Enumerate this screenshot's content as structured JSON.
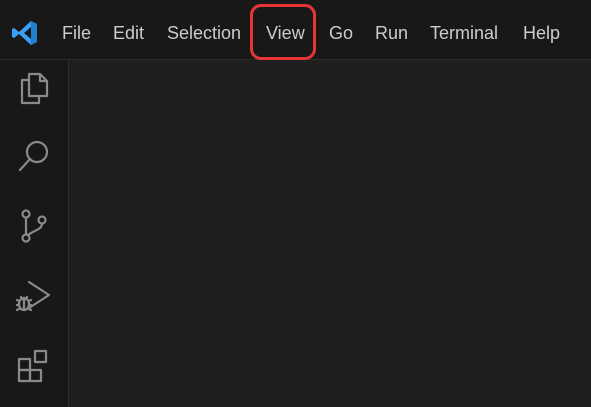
{
  "app": {
    "name": "Visual Studio Code",
    "logo_icon": "vscode-logo-icon",
    "logo_color": "#3aa0f3"
  },
  "menu": {
    "items": [
      {
        "label": "File"
      },
      {
        "label": "Edit"
      },
      {
        "label": "Selection"
      },
      {
        "label": "View"
      },
      {
        "label": "Go"
      },
      {
        "label": "Run"
      },
      {
        "label": "Terminal"
      },
      {
        "label": "Help"
      }
    ],
    "highlighted": "View",
    "highlight_color": "#e53535"
  },
  "activity_bar": {
    "items": [
      {
        "name": "explorer",
        "icon": "files-icon"
      },
      {
        "name": "search",
        "icon": "search-icon"
      },
      {
        "name": "source-control",
        "icon": "source-control-icon"
      },
      {
        "name": "run-and-debug",
        "icon": "run-debug-icon"
      },
      {
        "name": "extensions",
        "icon": "extensions-icon"
      }
    ],
    "icon_color": "#8a8a8a"
  },
  "colors": {
    "titlebar_bg": "#181818",
    "editor_bg": "#1f1f1f",
    "menu_text": "#cccccc"
  }
}
